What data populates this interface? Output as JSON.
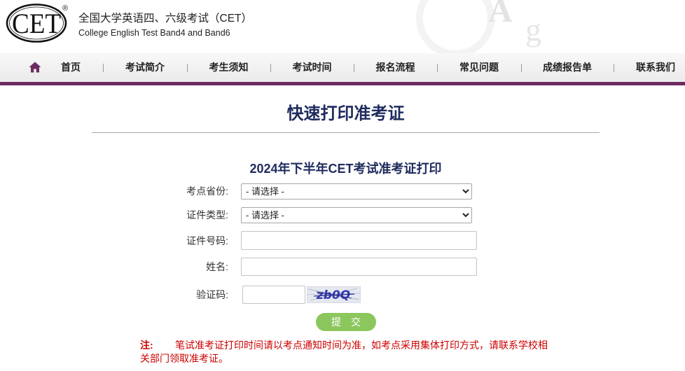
{
  "header": {
    "logo_text": "CET",
    "logo_mark": "®",
    "title_cn": "全国大学英语四、六级考试（CET）",
    "title_en": "College English Test Band4 and Band6",
    "watermark_letters": [
      "A",
      "g"
    ]
  },
  "nav": {
    "home_icon": "home-icon",
    "items": [
      "首页",
      "考试简介",
      "考生须知",
      "考试时间",
      "报名流程",
      "常见问题",
      "成绩报告单",
      "联系我们"
    ]
  },
  "page": {
    "title": "快速打印准考证",
    "subtitle": "2024年下半年CET考试准考证打印"
  },
  "form": {
    "province": {
      "label": "考点省份:",
      "selected": "- 请选择 -"
    },
    "id_type": {
      "label": "证件类型:",
      "selected": "- 请选择 -"
    },
    "id_number": {
      "label": "证件号码:",
      "value": ""
    },
    "name": {
      "label": "姓名:",
      "value": ""
    },
    "captcha": {
      "label": "验证码:",
      "value": "",
      "image_text": "zb0Q"
    },
    "submit_label": "提　交"
  },
  "note": {
    "prefix": "注:",
    "text": "笔试准考证打印时间请以考点通知时间为准，如考点采用集体打印方式，请联系学校相关部门领取准考证。"
  },
  "colors": {
    "accent": "#6e2b62",
    "heading": "#1f2b5e",
    "note": "#cc0000",
    "submit": "#8cc75e"
  }
}
